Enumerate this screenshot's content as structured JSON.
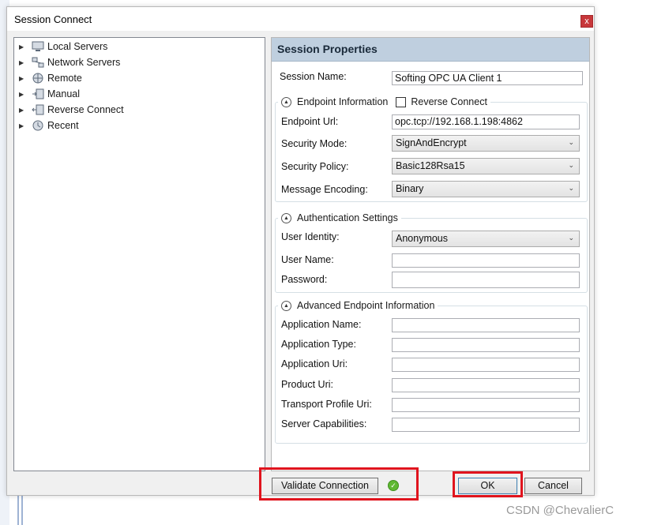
{
  "window": {
    "title": "Session Connect",
    "close_glyph": "x"
  },
  "tree": {
    "items": [
      {
        "label": "Local Servers",
        "icon": "computer-icon"
      },
      {
        "label": "Network Servers",
        "icon": "network-icon"
      },
      {
        "label": "Remote",
        "icon": "globe-icon"
      },
      {
        "label": "Manual",
        "icon": "manual-icon"
      },
      {
        "label": "Reverse Connect",
        "icon": "reverse-connect-icon"
      },
      {
        "label": "Recent",
        "icon": "recent-icon"
      }
    ]
  },
  "props": {
    "header": "Session Properties",
    "session_name_label": "Session Name:",
    "session_name_value": "Softing OPC UA Client 1",
    "endpoint": {
      "title": "Endpoint Information",
      "reverse_connect_label": "Reverse Connect",
      "url_label": "Endpoint Url:",
      "url_value": "opc.tcp://192.168.1.198:4862",
      "security_mode_label": "Security Mode:",
      "security_mode_value": "SignAndEncrypt",
      "security_policy_label": "Security Policy:",
      "security_policy_value": "Basic128Rsa15",
      "encoding_label": "Message Encoding:",
      "encoding_value": "Binary"
    },
    "auth": {
      "title": "Authentication Settings",
      "identity_label": "User Identity:",
      "identity_value": "Anonymous",
      "username_label": "User Name:",
      "password_label": "Password:"
    },
    "advanced": {
      "title": "Advanced Endpoint Information",
      "app_name_label": "Application Name:",
      "app_type_label": "Application Type:",
      "app_uri_label": "Application Uri:",
      "product_uri_label": "Product Uri:",
      "transport_label": "Transport Profile Uri:",
      "capabilities_label": "Server Capabilities:"
    }
  },
  "buttons": {
    "validate": "Validate Connection",
    "ok": "OK",
    "cancel": "Cancel"
  },
  "watermark": "CSDN @ChevalierC",
  "colors": {
    "highlight": "#e0141e",
    "header_bg": "#bfcfdf",
    "close_bg": "#c7373a"
  }
}
